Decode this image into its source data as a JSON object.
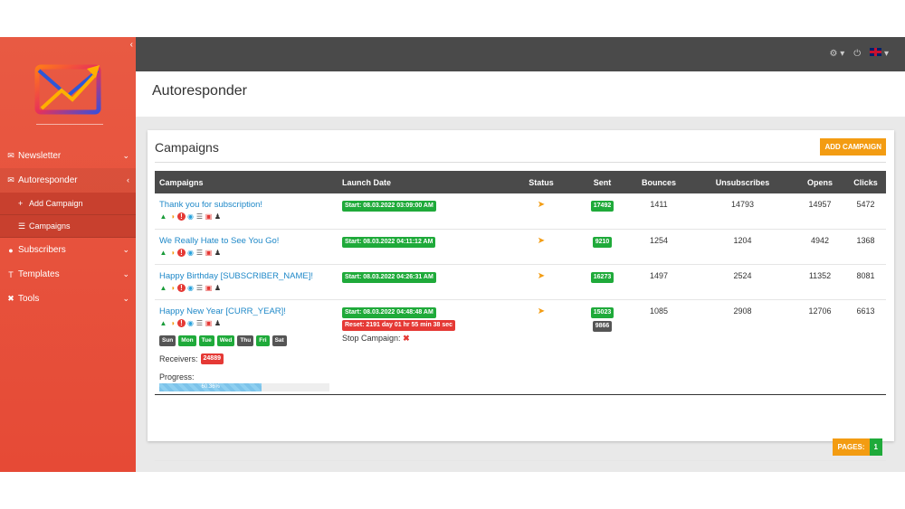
{
  "header": {
    "title": "Autoresponder"
  },
  "sidebar": {
    "items": [
      {
        "label": "Newsletter",
        "icon": "envelope-icon"
      },
      {
        "label": "Autoresponder",
        "icon": "autoresponder-icon"
      },
      {
        "label": "Subscribers",
        "icon": "users-icon"
      },
      {
        "label": "Templates",
        "icon": "template-icon"
      },
      {
        "label": "Tools",
        "icon": "tools-icon"
      }
    ],
    "subitems": [
      {
        "label": "Add Campaign"
      },
      {
        "label": "Campaigns"
      }
    ]
  },
  "card": {
    "title": "Campaigns",
    "add_button": "ADD CAMPAIGN",
    "pages_label": "PAGES:",
    "page_number": "1"
  },
  "table": {
    "headers": [
      "Campaigns",
      "Launch Date",
      "Status",
      "Sent",
      "Bounces",
      "Unsubscribes",
      "Opens",
      "Clicks"
    ],
    "rows": [
      {
        "name": "Thank you for subscription!",
        "launch": "Start: 08.03.2022 03:09:00 AM",
        "sent": "17492",
        "bounces": "1411",
        "unsubscribes": "14793",
        "opens": "14957",
        "clicks": "5472"
      },
      {
        "name": "We Really Hate to See You Go!",
        "launch": "Start: 08.03.2022 04:11:12 AM",
        "sent": "9210",
        "bounces": "1254",
        "unsubscribes": "1204",
        "opens": "4942",
        "clicks": "1368"
      },
      {
        "name": "Happy Birthday [SUBSCRIBER_NAME]!",
        "launch": "Start: 08.03.2022 04:26:31 AM",
        "sent": "16273",
        "bounces": "1497",
        "unsubscribes": "2524",
        "opens": "11352",
        "clicks": "8081"
      },
      {
        "name": "Happy New Year [CURR_YEAR]!",
        "launch": "Start: 08.03.2022 04:48:48 AM",
        "reset": "Reset: 2191 day 01 hr 55 min 38 sec",
        "stop": "Stop Campaign:",
        "sent": "15023",
        "sent2": "9866",
        "bounces": "1085",
        "unsubscribes": "2908",
        "opens": "12706",
        "clicks": "6613",
        "days": [
          "Sun",
          "Mon",
          "Tue",
          "Wed",
          "Thu",
          "Fri",
          "Sat"
        ],
        "receivers_label": "Receivers:",
        "receivers": "24889",
        "progress_label": "Progress:",
        "progress_text": "60.36%",
        "progress": 60.36
      }
    ]
  },
  "colors": {
    "sidebar": "#e64a36",
    "accent": "#f39c12",
    "green": "#1faa3a",
    "red": "#e53935",
    "link": "#1e88c8"
  }
}
